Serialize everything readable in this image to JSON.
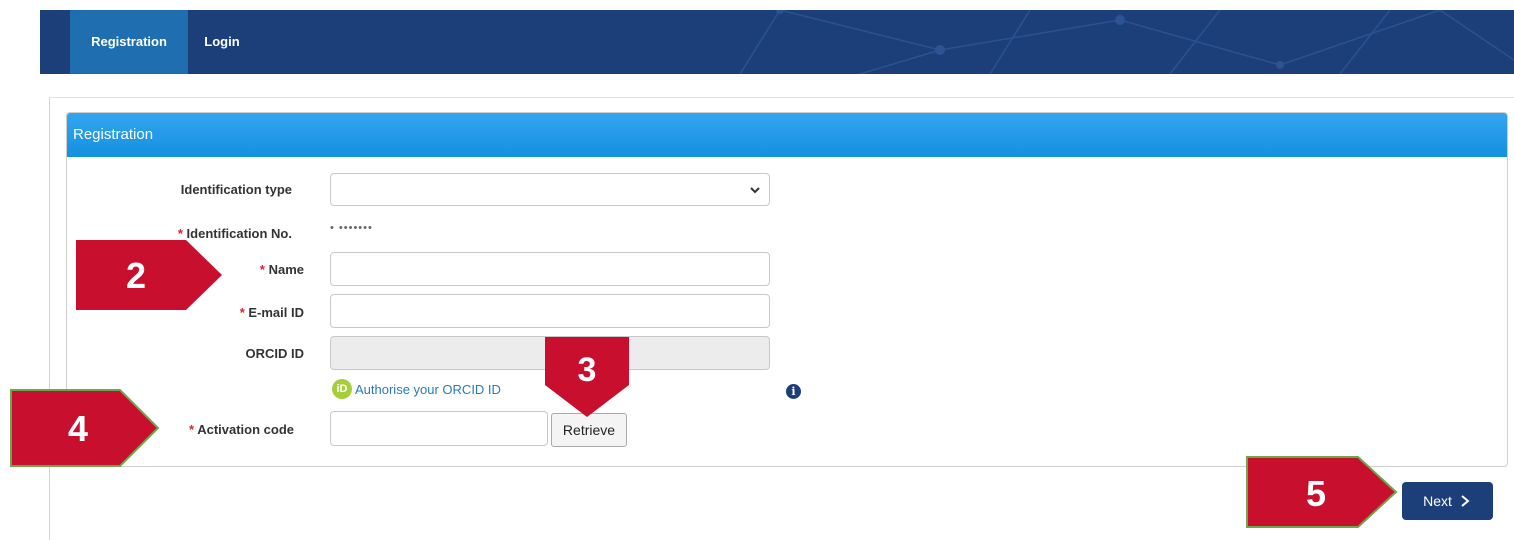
{
  "nav": {
    "tabs": [
      {
        "label": "Registration",
        "active": true
      },
      {
        "label": "Login",
        "active": false
      }
    ]
  },
  "panel": {
    "title": "Registration"
  },
  "form": {
    "identification_type": {
      "label": "Identification type",
      "value": ""
    },
    "identification_no": {
      "label": "Identification No.",
      "value": "• •••••••"
    },
    "name": {
      "label": "Name",
      "value": ""
    },
    "email": {
      "label": "E-mail ID",
      "value": ""
    },
    "orcid": {
      "label": "ORCID ID",
      "value": "",
      "disabled": true
    },
    "orcid_link": {
      "badge": "iD",
      "text": "Authorise your ORCID ID"
    },
    "activation_code": {
      "label": "Activation code",
      "value": ""
    },
    "retrieve_button": "Retrieve",
    "required_mark": "*"
  },
  "next_button": {
    "label": "Next",
    "icon": "chevron-right-icon"
  },
  "annotations": [
    "2",
    "3",
    "4",
    "5"
  ],
  "colors": {
    "navbar": "#1d3f79",
    "active_tab": "#1f6fb0",
    "panel_header": "#1a9ae8",
    "marker": "#c8102e",
    "marker_border": "#6aa84f",
    "required": "#d9232e"
  }
}
